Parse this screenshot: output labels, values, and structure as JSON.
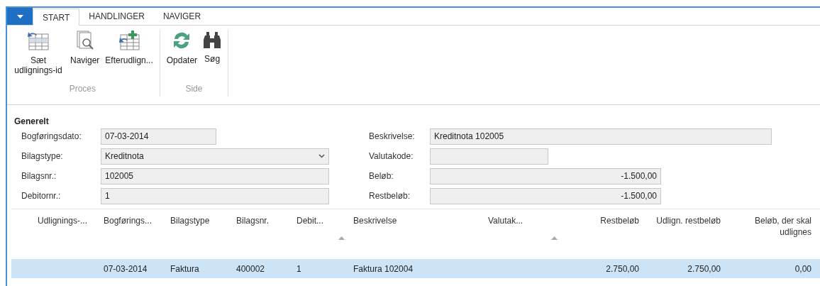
{
  "ribbon": {
    "tabs": [
      {
        "label": "START",
        "selected": true
      },
      {
        "label": "HANDLINGER",
        "selected": false
      },
      {
        "label": "NAVIGER",
        "selected": false
      }
    ],
    "groups": [
      {
        "label": "Proces",
        "buttons": [
          {
            "label": "Sæt udlignings-id",
            "kind": "set-id"
          },
          {
            "label": "Naviger",
            "kind": "navigate"
          },
          {
            "label": "Efterudlign...",
            "kind": "post"
          }
        ]
      },
      {
        "label": "Side",
        "buttons": [
          {
            "label": "Opdater",
            "kind": "refresh"
          },
          {
            "label": "Søg",
            "kind": "find"
          }
        ]
      }
    ]
  },
  "general": {
    "title": "Generelt",
    "left": [
      {
        "label": "Bogføringsdato:",
        "value": "07-03-2014",
        "kind": "short"
      },
      {
        "label": "Bilagstype:",
        "value": "Kreditnota",
        "kind": "dropdown"
      },
      {
        "label": "Bilagsnr.:",
        "value": "102005",
        "kind": "text"
      },
      {
        "label": "Debitornr.:",
        "value": "1",
        "kind": "text"
      }
    ],
    "right": [
      {
        "label": "Beskrivelse:",
        "value": "Kreditnota 102005",
        "kind": "wide"
      },
      {
        "label": "Valutakode:",
        "kind": "small"
      },
      {
        "label": "Beløb:",
        "value": "-1.500,00",
        "kind": "amount"
      },
      {
        "label": "Restbeløb:",
        "value": "-1.500,00",
        "kind": "amount"
      }
    ]
  },
  "table": {
    "columns": [
      {
        "label": "Udlignings-...",
        "kind": "text",
        "sorted": false
      },
      {
        "label": "Bogførings...",
        "kind": "text",
        "sorted": false
      },
      {
        "label": "Bilagstype",
        "kind": "text",
        "sorted": false
      },
      {
        "label": "Bilagsnr.",
        "kind": "text",
        "sorted": false
      },
      {
        "label": "Debit...",
        "kind": "text",
        "sorted": true
      },
      {
        "label": "Beskrivelse",
        "kind": "text",
        "sorted": false
      },
      {
        "label": "Valutak...",
        "kind": "text",
        "sorted": true
      },
      {
        "label": "Restbeløb",
        "kind": "amount",
        "sorted": false
      },
      {
        "label": "Udlign. restbeløb",
        "kind": "amount",
        "sorted": false
      },
      {
        "label": "Beløb, der skal udlignes",
        "kind": "amount",
        "sorted": false
      }
    ],
    "rows": [
      {
        "selected": true,
        "cells": [
          "",
          "07-03-2014",
          "Faktura",
          "400002",
          "1",
          "Faktura 102004",
          "",
          "2.750,00",
          "2.750,00",
          "0,00"
        ]
      }
    ]
  }
}
